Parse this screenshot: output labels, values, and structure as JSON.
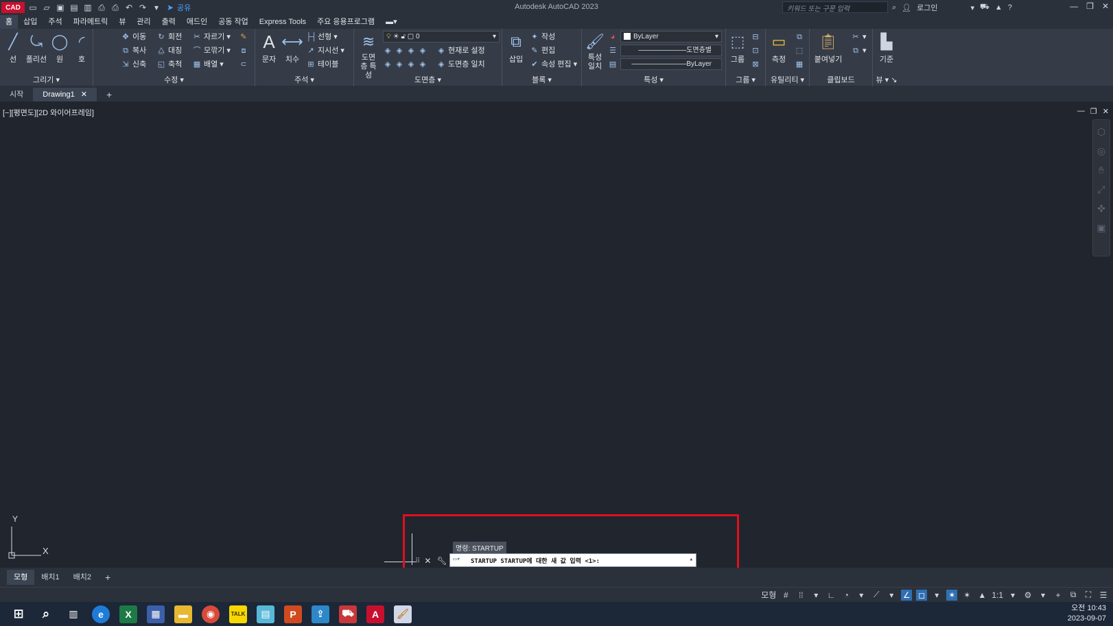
{
  "app": {
    "logo": "CAD",
    "window_title": "Autodesk AutoCAD 2023",
    "share_label": "공유",
    "search_placeholder": "키워드 또는 구문 입력",
    "login_label": "로그인"
  },
  "menu": [
    "홈",
    "삽입",
    "주석",
    "파라메트릭",
    "뷰",
    "관리",
    "출력",
    "애드인",
    "공동 작업",
    "Express Tools",
    "주요 응용프로그램"
  ],
  "ribbon": {
    "draw": {
      "title": "그리기",
      "line": "선",
      "polyline": "폴리선",
      "circle": "원",
      "arc": "호"
    },
    "modify": {
      "title": "수정",
      "move": "이동",
      "rotate": "회전",
      "trim": "자르기",
      "copy": "복사",
      "mirror": "대칭",
      "fillet": "모깎기",
      "stretch": "신축",
      "scale": "축척",
      "array": "배열"
    },
    "annotation": {
      "title": "주석",
      "text": "문자",
      "dimension": "치수",
      "linear": "선형",
      "leader": "지시선",
      "table": "테이블"
    },
    "layers": {
      "title": "도면층",
      "properties": "도면층 특성",
      "current_layer": "0",
      "make_current": "현재로 설정",
      "match_layer": "도면층 일치"
    },
    "block": {
      "title": "블록",
      "insert": "삽입",
      "create": "작성",
      "edit": "편집",
      "edit_attrs": "속성 편집"
    },
    "properties": {
      "title": "특성",
      "match": "특성 일치",
      "color": "ByLayer",
      "linetype": "도면층별",
      "lineweight": "ByLayer"
    },
    "groups": {
      "title": "그룹",
      "group": "그룹"
    },
    "utilities": {
      "title": "유틸리티",
      "measure": "측정"
    },
    "clipboard": {
      "title": "클립보드",
      "paste": "붙여넣기"
    },
    "view": {
      "title": "뷰",
      "base": "기준"
    }
  },
  "file_tabs": {
    "start": "시작",
    "drawing": "Drawing1"
  },
  "viewport": {
    "label": "[−][평면도][2D 와이어프레임]",
    "axis_y": "Y",
    "axis_x": "X"
  },
  "command": {
    "history": "명령: STARTUP",
    "prompt": "STARTUP STARTUP에 대한 새 값 입력 <1>:"
  },
  "layout_tabs": [
    "모형",
    "배치1",
    "배치2"
  ],
  "status": {
    "model_label": "모형",
    "scale": "1:1"
  },
  "clock": {
    "time": "오전 10:43",
    "date": "2023-09-07"
  }
}
